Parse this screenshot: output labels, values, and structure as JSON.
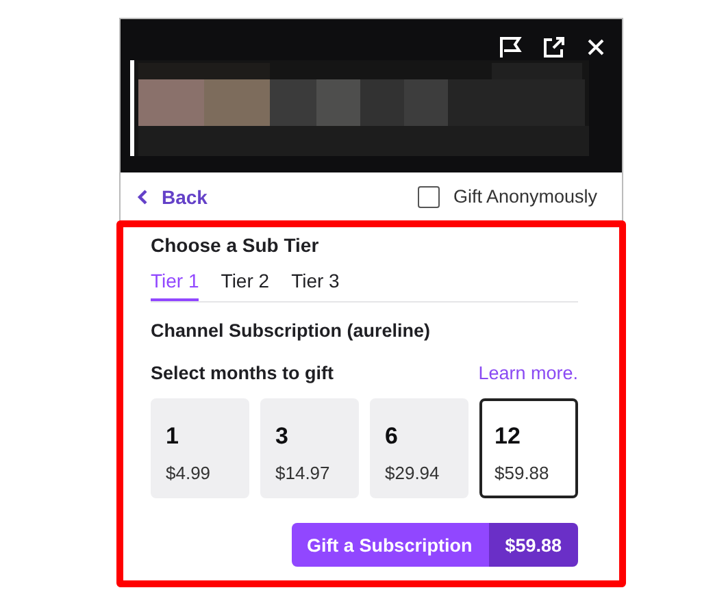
{
  "nav": {
    "back": "Back",
    "gift_anonymously": {
      "label": "Gift Anonymously",
      "checked": false
    }
  },
  "tier_section": {
    "title": "Choose a Sub Tier",
    "tabs": [
      {
        "label": "Tier 1",
        "selected": true
      },
      {
        "label": "Tier 2",
        "selected": false
      },
      {
        "label": "Tier 3",
        "selected": false
      }
    ],
    "product": "Channel Subscription (aureline)",
    "months_label": "Select months to gift",
    "learn_more": "Learn more.",
    "options": [
      {
        "months": "1",
        "price": "$4.99",
        "selected": false
      },
      {
        "months": "3",
        "price": "$14.97",
        "selected": false
      },
      {
        "months": "6",
        "price": "$29.94",
        "selected": false
      },
      {
        "months": "12",
        "price": "$59.88",
        "selected": true
      }
    ],
    "gift_button": {
      "label": "Gift a Subscription",
      "price": "$59.88"
    }
  }
}
